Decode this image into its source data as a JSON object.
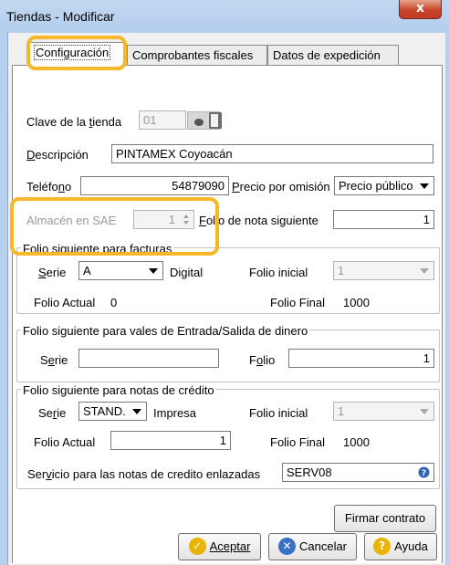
{
  "window": {
    "title": "Tiendas - Modificar",
    "close": "x"
  },
  "tabs": [
    {
      "label": "Configuración"
    },
    {
      "label": "Comprobantes fiscales"
    },
    {
      "label": "Datos de expedición"
    }
  ],
  "store": {
    "clave_label": "Clave de la tienda",
    "clave_value": "01",
    "descripcion_label": "Descripción",
    "descripcion_value": "PINTAMEX Coyoacán",
    "telefono_label": "Teléfono",
    "telefono_value": "54879090",
    "precio_label": "Precio por omisión",
    "precio_value": "Precio público",
    "almacen_label": "Almacén en SAE",
    "almacen_value": "1",
    "folio_nota_label": "Folio de nota siguiente",
    "folio_nota_value": "1"
  },
  "facturas": {
    "title": "Folio siguiente para facturas",
    "serie_label": "Serie",
    "serie_value": "A",
    "type_text": "Digital",
    "folio_inicial_label": "Folio inicial",
    "folio_inicial_value": "1",
    "folio_actual_label": "Folio Actual",
    "folio_actual_value": "0",
    "folio_final_label": "Folio Final",
    "folio_final_value": "1000"
  },
  "vales": {
    "title": "Folio siguiente para vales de Entrada/Salida de dinero",
    "serie_label": "Serie",
    "serie_value": "",
    "folio_label": "Folio",
    "folio_value": "1"
  },
  "notas": {
    "title": "Folio siguiente para notas de crédito",
    "serie_label": "Serie",
    "serie_value": "STAND.",
    "type_text": "Impresa",
    "folio_inicial_label": "Folio inicial",
    "folio_inicial_value": "1",
    "folio_actual_label": "Folio Actual",
    "folio_actual_value": "1",
    "folio_final_label": "Folio Final",
    "folio_final_value": "1000"
  },
  "servicio": {
    "label": "Servicio para las notas de credito enlazadas",
    "value": "SERV08"
  },
  "buttons": {
    "firmar": "Firmar contrato",
    "aceptar": "Aceptar",
    "cancelar": "Cancelar",
    "ayuda": "Ayuda"
  },
  "colors": {
    "highlight": "#f7b72a",
    "accent_blue": "#3b6fc4",
    "close_red": "#c8462c"
  },
  "icons": [
    "close-icon",
    "camera-icon",
    "door-icon",
    "spin-icon",
    "dropdown-arrow-icon",
    "info-icon",
    "check-icon",
    "x-icon",
    "help-icon"
  ]
}
